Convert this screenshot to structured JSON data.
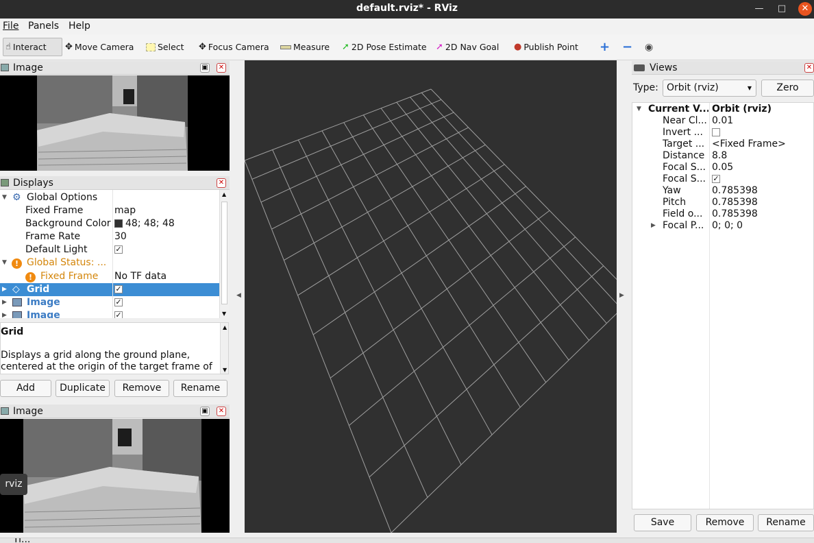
{
  "window": {
    "title": "default.rviz* - RViz"
  },
  "menu": {
    "file": "File",
    "panels": "Panels",
    "help": "Help"
  },
  "toolbar": {
    "interact": "Interact",
    "move_camera": "Move Camera",
    "select": "Select",
    "focus_camera": "Focus Camera",
    "measure": "Measure",
    "pose_estimate": "2D Pose Estimate",
    "nav_goal": "2D Nav Goal",
    "publish_point": "Publish Point"
  },
  "image_panel_top": {
    "title": "Image"
  },
  "displays": {
    "title": "Displays",
    "global_options": "Global Options",
    "fixed_frame_label": "Fixed Frame",
    "fixed_frame_value": "map",
    "bg_label": "Background Color",
    "bg_value": "48; 48; 48",
    "bg_color": "#303030",
    "frame_rate_label": "Frame Rate",
    "frame_rate_value": "30",
    "default_light_label": "Default Light",
    "global_status": "Global Status: ...",
    "status_fixed_frame": "Fixed Frame",
    "status_value": "No TF data",
    "grid_label": "Grid",
    "image1_label": "Image",
    "image2_label": "Image",
    "warn_color": "#d4860b",
    "select_color": "#3c8dd4"
  },
  "description": {
    "title": "Grid",
    "text1": "Displays a grid along the ground plane,",
    "text2": "centered at the origin of the target frame of"
  },
  "display_buttons": {
    "add": "Add",
    "duplicate": "Duplicate",
    "remove": "Remove",
    "rename": "Rename"
  },
  "image_panel_bottom": {
    "title": "Image"
  },
  "tooltip": "rviz",
  "views": {
    "title": "Views",
    "type_label": "Type:",
    "type_value": "Orbit (rviz)",
    "zero": "Zero",
    "current_label": "Current V...",
    "current_value": "Orbit (rviz)",
    "near_clip_label": "Near Cl...",
    "near_clip_value": "0.01",
    "invert_label": "Invert ...",
    "target_label": "Target ...",
    "target_value": "<Fixed Frame>",
    "distance_label": "Distance",
    "distance_value": "8.8",
    "focal_size_label": "Focal S...",
    "focal_size_value": "0.05",
    "focal_shape_label": "Focal S...",
    "yaw_label": "Yaw",
    "yaw_value": "0.785398",
    "pitch_label": "Pitch",
    "pitch_value": "0.785398",
    "fov_label": "Field o...",
    "fov_value": "0.785398",
    "focal_point_label": "Focal P...",
    "focal_point_value": "0; 0; 0",
    "save": "Save",
    "remove": "Remove",
    "rename": "Rename"
  },
  "bottom_panel": {
    "title": "Ti..."
  }
}
